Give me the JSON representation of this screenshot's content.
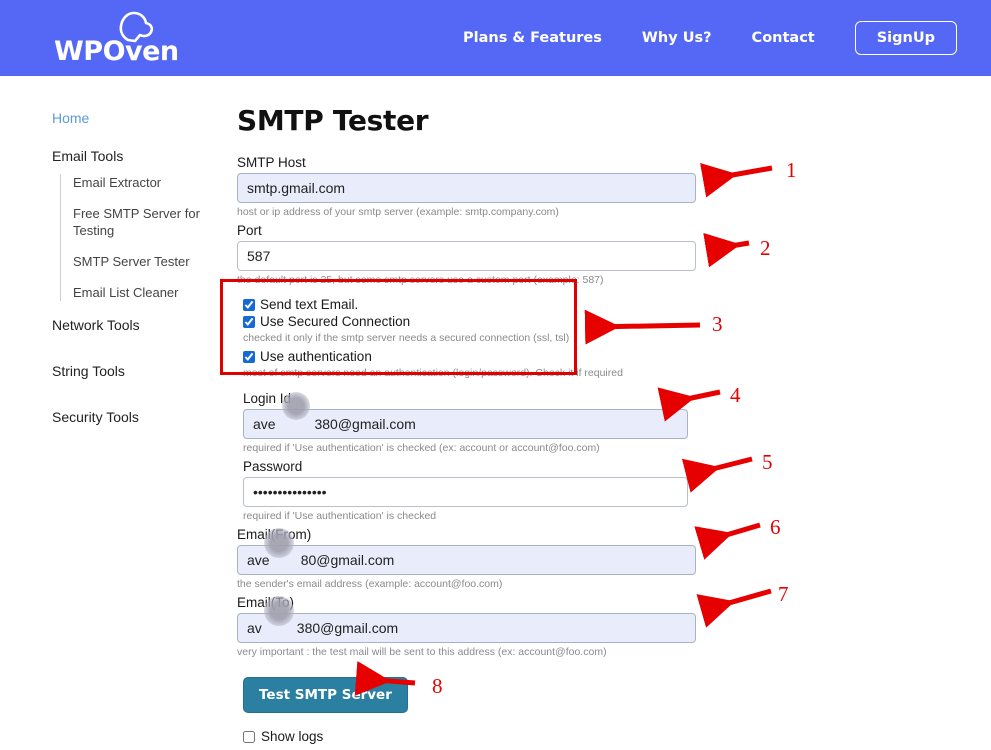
{
  "header": {
    "logo_text": "WPOven",
    "logo_icon": "cloud-oven-icon",
    "nav": [
      {
        "label": "Plans & Features"
      },
      {
        "label": "Why Us?"
      },
      {
        "label": "Contact"
      }
    ],
    "signup_label": "SignUp"
  },
  "sidebar": {
    "home": "Home",
    "groups": [
      {
        "label": "Email Tools",
        "items": [
          "Email Extractor",
          "Free SMTP Server for Testing",
          "SMTP Server Tester",
          "Email List Cleaner"
        ]
      },
      {
        "label": "Network Tools",
        "items": []
      },
      {
        "label": "String Tools",
        "items": []
      },
      {
        "label": "Security Tools",
        "items": []
      }
    ]
  },
  "main": {
    "title": "SMTP Tester",
    "fields": {
      "smtp_host": {
        "label": "SMTP Host",
        "value": "smtp.gmail.com",
        "hint": "host or ip address of your smtp server (example: smtp.company.com)"
      },
      "port": {
        "label": "Port",
        "value": "587",
        "hint": "the default port is 25, but some smtp servers use a custom port (example: 587)"
      },
      "login_id": {
        "label": "Login Id",
        "value": "ave          380@gmail.com",
        "hint": "required if 'Use authentication' is checked (ex: account or account@foo.com)"
      },
      "password": {
        "label": "Password",
        "value": "•••••••••••••••",
        "hint": "required if 'Use authentication' is checked"
      },
      "email_from": {
        "label": "Email(From)",
        "value": "ave        80@gmail.com",
        "hint": "the sender's email address (example: account@foo.com)"
      },
      "email_to": {
        "label": "Email(To)",
        "value": "av         380@gmail.com",
        "hint": "very important : the test mail will be sent to this address (ex: account@foo.com)"
      }
    },
    "checkboxes": [
      {
        "label": "Send text Email.",
        "checked": true,
        "hint": ""
      },
      {
        "label": "Use Secured Connection",
        "checked": true,
        "hint": "checked it only if the smtp server needs a secured connection (ssl, tsl)"
      },
      {
        "label": "Use authentication",
        "checked": true,
        "hint": "most of smtp servers need an authentication (login/password). Check it if required"
      }
    ],
    "submit_label": "Test SMTP Server",
    "show_logs": {
      "label": "Show logs",
      "checked": false
    }
  },
  "annotations": {
    "color": "#e60000",
    "numbers": [
      "1",
      "2",
      "3",
      "4",
      "5",
      "6",
      "7",
      "8"
    ]
  },
  "colors": {
    "header_bg": "#5468f5",
    "accent_button": "#2b7fa0",
    "autofill_bg": "#e9ecfb",
    "annotation_red": "#e60000",
    "sidebar_link": "#5b9bd5"
  }
}
